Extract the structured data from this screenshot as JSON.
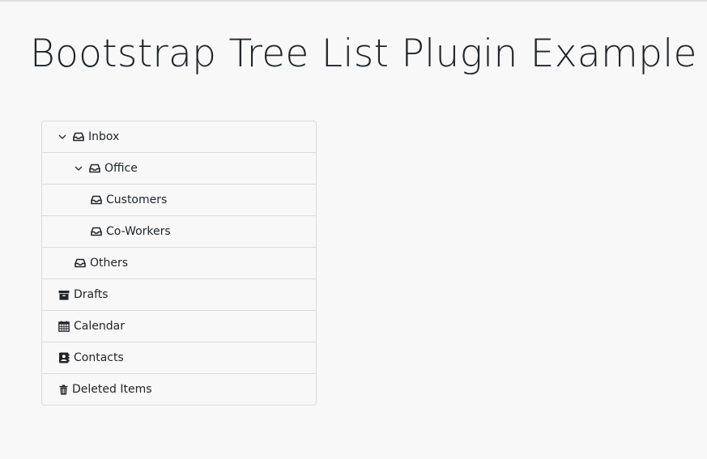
{
  "page": {
    "title": "Bootstrap Tree List Plugin Example"
  },
  "tree": {
    "items": [
      {
        "label": "Inbox",
        "icon": "inbox-icon",
        "expanded": true
      },
      {
        "label": "Office",
        "icon": "inbox-icon",
        "expanded": true
      },
      {
        "label": "Customers",
        "icon": "inbox-icon"
      },
      {
        "label": "Co-Workers",
        "icon": "inbox-icon"
      },
      {
        "label": "Others",
        "icon": "inbox-icon"
      },
      {
        "label": "Drafts",
        "icon": "archive-icon"
      },
      {
        "label": "Calendar",
        "icon": "calendar-icon"
      },
      {
        "label": "Contacts",
        "icon": "address-book-icon"
      },
      {
        "label": "Deleted Items",
        "icon": "trash-icon"
      }
    ]
  },
  "colors": {
    "background": "#f8f8f8",
    "text": "#212529",
    "border": "#dcdcdc"
  }
}
